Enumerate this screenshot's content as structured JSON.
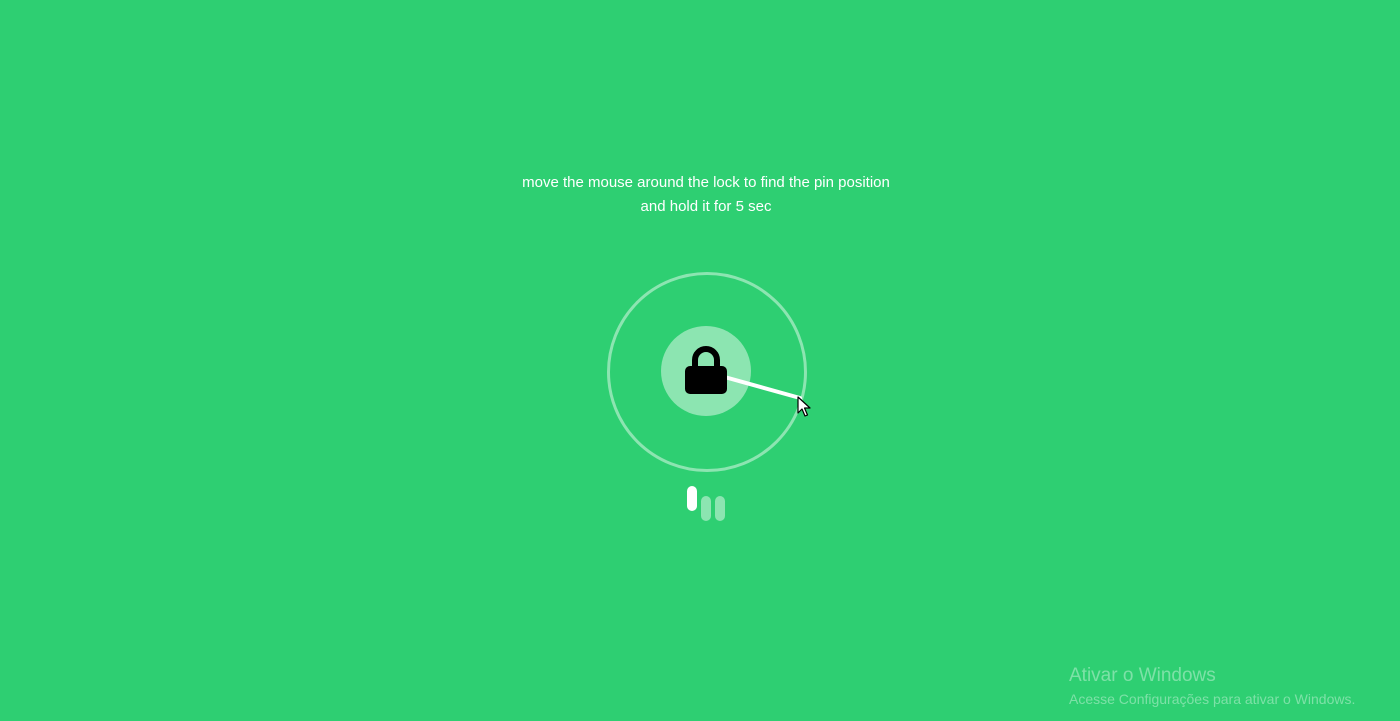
{
  "instructions": {
    "line1": "move the mouse around the lock to find the pin position",
    "line2": "and hold it for 5 sec"
  },
  "lock": {
    "icon": "lock-icon",
    "ring_color": "rgba(255,255,255,0.45)",
    "core_color": "rgba(255,255,255,0.45)"
  },
  "progress": {
    "total_steps": 3,
    "current_step": 1
  },
  "colors": {
    "background": "#2ecf72",
    "text": "#ffffff",
    "icon": "#000000"
  },
  "watermark": {
    "title": "Ativar o Windows",
    "subtitle": "Acesse Configurações para ativar o Windows."
  }
}
